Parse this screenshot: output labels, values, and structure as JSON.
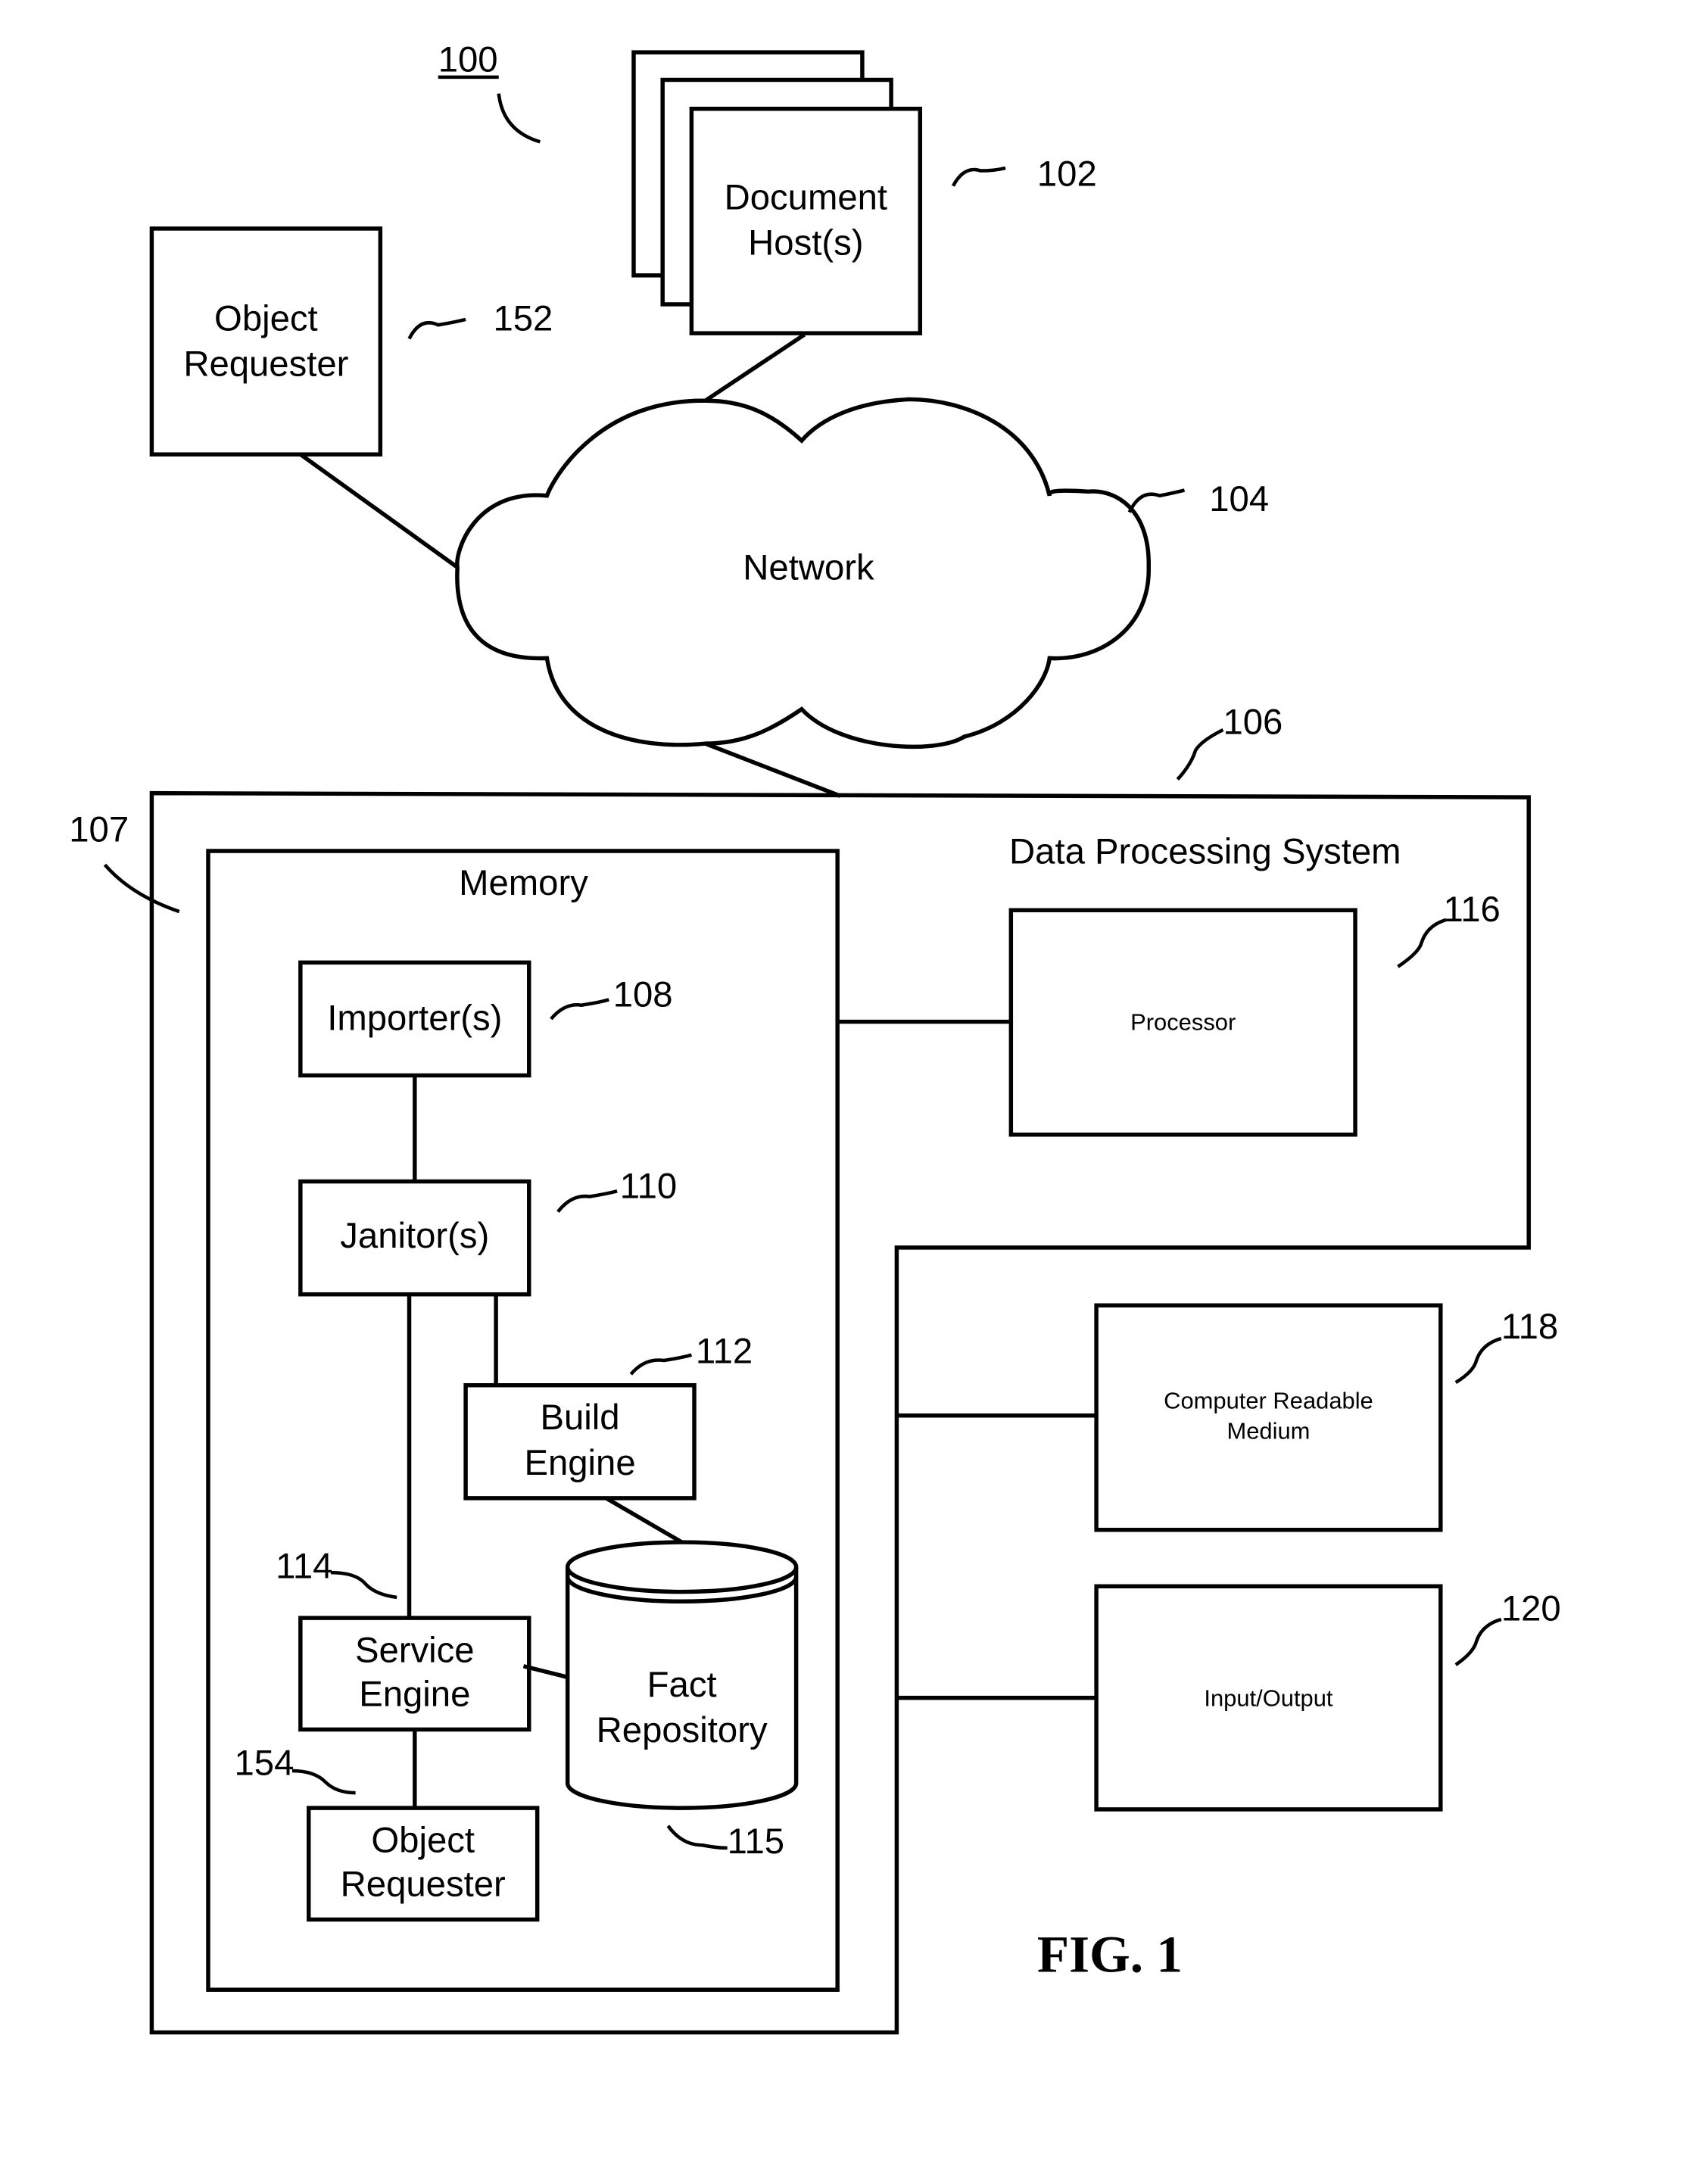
{
  "figure": {
    "caption": "FIG. 1",
    "system_ref": "100"
  },
  "document_hosts": {
    "label_line1": "Document",
    "label_line2": "Host(s)",
    "ref": "102"
  },
  "object_requester_external": {
    "label_line1": "Object",
    "label_line2": "Requester",
    "ref": "152"
  },
  "network": {
    "label": "Network",
    "ref": "104"
  },
  "data_processing_system": {
    "label": "Data Processing System",
    "ref": "106",
    "outer_ref": "107"
  },
  "memory": {
    "label": "Memory",
    "importers": {
      "label": "Importer(s)",
      "ref": "108"
    },
    "janitors": {
      "label": "Janitor(s)",
      "ref": "110"
    },
    "build_engine": {
      "label_line1": "Build",
      "label_line2": "Engine",
      "ref": "112"
    },
    "service_engine": {
      "label_line1": "Service",
      "label_line2": "Engine",
      "ref": "114"
    },
    "fact_repository": {
      "label_line1": "Fact",
      "label_line2": "Repository",
      "ref": "115"
    },
    "object_requester": {
      "label_line1": "Object",
      "label_line2": "Requester",
      "ref": "154"
    }
  },
  "processor": {
    "label": "Processor",
    "ref": "116"
  },
  "computer_readable_medium": {
    "label_line1": "Computer Readable",
    "label_line2": "Medium",
    "ref": "118"
  },
  "input_output": {
    "label": "Input/Output",
    "ref": "120"
  }
}
